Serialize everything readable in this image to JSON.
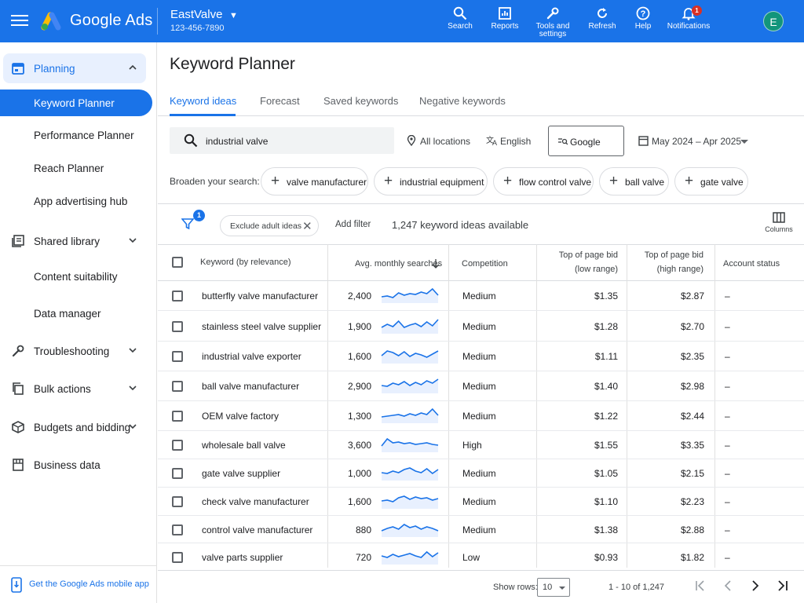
{
  "topbar": {
    "brand": "Google Ads",
    "account_name": "EastValve",
    "account_number": "123-456-7890",
    "items": [
      {
        "label": "Search"
      },
      {
        "label": "Reports"
      },
      {
        "label": "Tools and settings"
      },
      {
        "label": "Refresh"
      },
      {
        "label": "Help"
      },
      {
        "label": "Notifications",
        "badge": "1"
      }
    ],
    "avatar_letter": "E"
  },
  "sidebar": {
    "planning": "Planning",
    "sub_items": [
      "Keyword Planner",
      "Performance Planner",
      "Reach Planner",
      "App advertising hub"
    ],
    "shared_library": "Shared library",
    "content_suitability": "Content suitability",
    "data_manager": "Data manager",
    "troubleshooting": "Troubleshooting",
    "bulk_actions": "Bulk actions",
    "budgets_bidding": "Budgets and bidding",
    "business_data": "Business data",
    "mobile_app": "Get the Google Ads mobile app"
  },
  "main": {
    "title": "Keyword Planner",
    "tabs": [
      "Keyword ideas",
      "Forecast",
      "Saved keywords",
      "Negative keywords"
    ],
    "search_value": "industrial valve",
    "locations": "All locations",
    "language": "English",
    "network": "Google",
    "date_range": "May 2024 – Apr 2025",
    "broaden_label": "Broaden your search:",
    "broaden_chips": [
      "valve manufacturer",
      "industrial equipment",
      "flow control valve",
      "ball valve",
      "gate valve"
    ],
    "filter_badge": "1",
    "exclude_chip": "Exclude adult ideas",
    "add_filter": "Add filter",
    "available": "1,247 keyword ideas available",
    "columns_label": "Columns"
  },
  "table": {
    "headers": {
      "keyword": "Keyword (by relevance)",
      "searches": "Avg. monthly searches",
      "competition": "Competition",
      "low_bid_1": "Top of page bid",
      "low_bid_2": "(low range)",
      "high_bid_1": "Top of page bid",
      "high_bid_2": "(high range)",
      "status": "Account status"
    },
    "rows": [
      {
        "keyword": "butterfly valve manufacturer",
        "searches": "2,400",
        "competition": "Medium",
        "low": "$1.35",
        "high": "$2.87",
        "status": "–"
      },
      {
        "keyword": "stainless steel valve supplier",
        "searches": "1,900",
        "competition": "Medium",
        "low": "$1.28",
        "high": "$2.70",
        "status": "–"
      },
      {
        "keyword": "industrial valve exporter",
        "searches": "1,600",
        "competition": "Medium",
        "low": "$1.11",
        "high": "$2.35",
        "status": "–"
      },
      {
        "keyword": "ball valve manufacturer",
        "searches": "2,900",
        "competition": "Medium",
        "low": "$1.40",
        "high": "$2.98",
        "status": "–"
      },
      {
        "keyword": "OEM valve factory",
        "searches": "1,300",
        "competition": "Medium",
        "low": "$1.22",
        "high": "$2.44",
        "status": "–"
      },
      {
        "keyword": "wholesale ball valve",
        "searches": "3,600",
        "competition": "High",
        "low": "$1.55",
        "high": "$3.35",
        "status": "–"
      },
      {
        "keyword": "gate valve supplier",
        "searches": "1,000",
        "competition": "Medium",
        "low": "$1.05",
        "high": "$2.15",
        "status": "–"
      },
      {
        "keyword": "check valve manufacturer",
        "searches": "1,600",
        "competition": "Medium",
        "low": "$1.10",
        "high": "$2.23",
        "status": "–"
      },
      {
        "keyword": "control valve manufacturer",
        "searches": "880",
        "competition": "Medium",
        "low": "$1.38",
        "high": "$2.88",
        "status": "–"
      },
      {
        "keyword": "valve parts supplier",
        "searches": "720",
        "competition": "Low",
        "low": "$0.93",
        "high": "$1.82",
        "status": "–"
      }
    ]
  },
  "footer": {
    "show_rows": "Show rows:",
    "rows_value": "10",
    "range": "1 - 10 of 1,247"
  },
  "colors": {
    "primary": "#1a73e8",
    "badge": "#d93025",
    "avatar": "#12957b"
  }
}
